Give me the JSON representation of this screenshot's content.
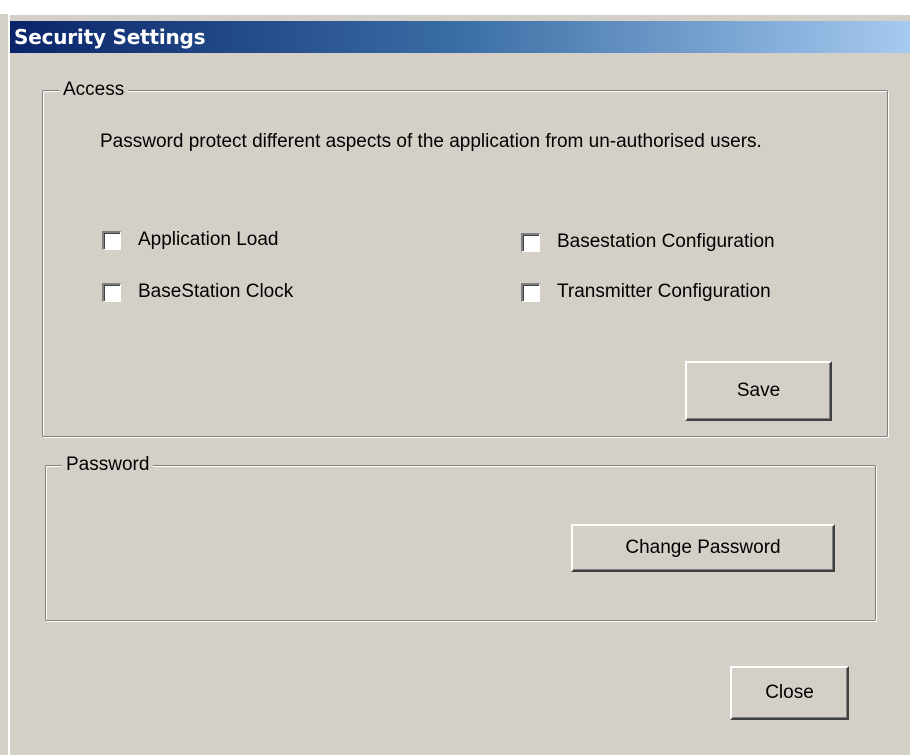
{
  "window": {
    "title": "Security Settings"
  },
  "access": {
    "legend": "Access",
    "description": "Password protect different aspects of the application from un-authorised users.",
    "checkboxes": [
      {
        "label": "Application Load",
        "checked": false
      },
      {
        "label": "BaseStation Clock",
        "checked": false
      },
      {
        "label": "Basestation Configuration",
        "checked": false
      },
      {
        "label": "Transmitter Configuration",
        "checked": false
      }
    ],
    "save_label": "Save"
  },
  "password": {
    "legend": "Password",
    "change_label": "Change Password"
  },
  "footer": {
    "close_label": "Close"
  }
}
